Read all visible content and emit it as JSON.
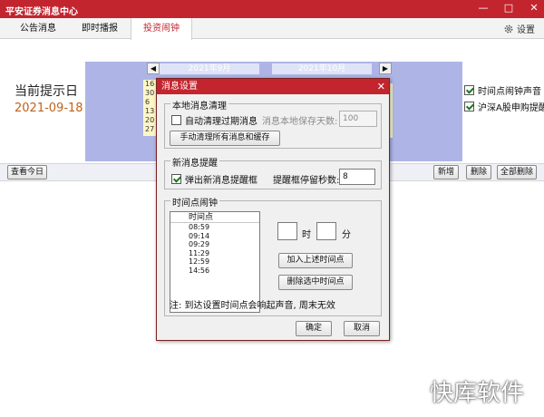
{
  "window": {
    "title": "平安证券消息中心",
    "controls": {
      "minimize": "—",
      "maximize": "□",
      "close": "✕"
    }
  },
  "tabs": [
    "公告消息",
    "即时播报",
    "投资闹钟"
  ],
  "active_tab": 2,
  "settings_label": "设置",
  "left_panel": {
    "label": "当前提示日",
    "date": "2021-09-18"
  },
  "calendar": {
    "left_month": "2021年9月",
    "right_month": "2021年10月",
    "visible_days": [
      "16",
      "30",
      "6",
      "13",
      "20",
      "27"
    ]
  },
  "right_checks": [
    {
      "label": "时间点闹钟声音",
      "checked": true
    },
    {
      "label": "沪深A股申购提醒",
      "checked": true
    }
  ],
  "toolbar": {
    "today": "查看今日",
    "add": "新增",
    "delete": "删除",
    "delete_all": "全部删除"
  },
  "dialog": {
    "title": "消息设置",
    "close": "✕",
    "local_group": {
      "label": "本地消息清理",
      "auto_clean": {
        "label": "自动清理过期消息",
        "checked": false
      },
      "keep_days_label": "消息本地保存天数:",
      "keep_days_value": "100",
      "manual_clean": "手动清理所有消息和缓存"
    },
    "new_msg_group": {
      "label": "新消息提醒",
      "popup": {
        "label": "弹出新消息提醒框",
        "checked": true
      },
      "stay_label": "提醒框停留秒数:",
      "stay_value": "8"
    },
    "alarm_group": {
      "label": "时间点闹钟",
      "list_header": "时间点",
      "times": [
        "08:59",
        "09:14",
        "09:29",
        "11:29",
        "12:59",
        "14:56"
      ],
      "hour_label": "时",
      "minute_label": "分",
      "add_button": "加入上述时间点",
      "remove_button": "删除选中时间点",
      "note": "注: 到达设置时间点会响起声音, 周末无效"
    },
    "ok": "确定",
    "cancel": "取消"
  },
  "watermark": "快库软件",
  "colors": {
    "brand_red": "#c3252f",
    "calendar_bg": "#aeb5e6",
    "date_orange": "#c0621a"
  }
}
